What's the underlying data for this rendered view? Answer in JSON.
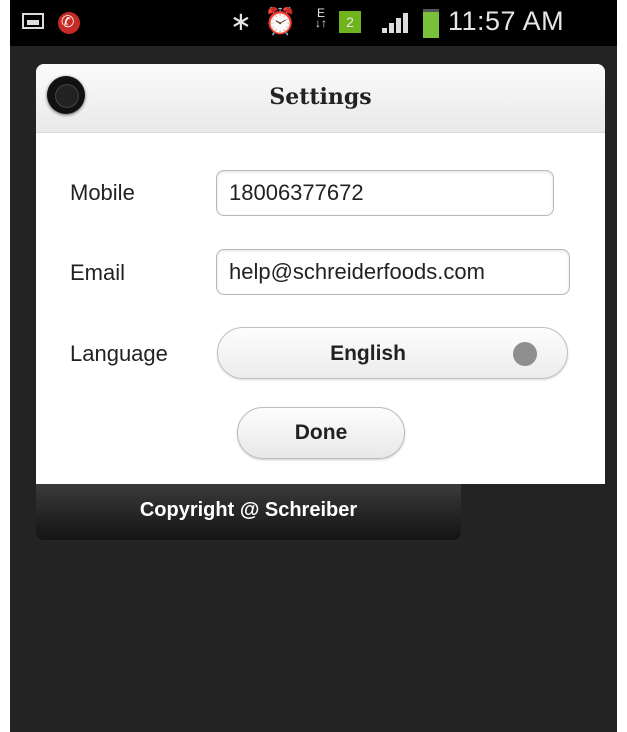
{
  "status_bar": {
    "icons": [
      "image-icon",
      "missed-call-icon",
      "bluetooth-icon",
      "alarm-icon",
      "data-transfer-icon",
      "sim-icon",
      "signal-icon",
      "battery-icon"
    ],
    "bt_glyph": "∗",
    "alarm_glyph": "⏰",
    "e_glyph": "E",
    "sim_number": "2",
    "time": "11:57 AM"
  },
  "dialog": {
    "title": "Settings",
    "mobile_label": "Mobile",
    "mobile_value": "18006377672",
    "email_label": "Email",
    "email_value": "help@schreiderfoods.com",
    "language_label": "Language",
    "language_value": "English",
    "done_label": "Done"
  },
  "footer": {
    "copyright": "Copyright @ Schreiber"
  },
  "colors": {
    "background": "#232323",
    "sim_badge": "#6fb41d",
    "battery": "#79c13a",
    "missed_call": "#c62b25"
  }
}
